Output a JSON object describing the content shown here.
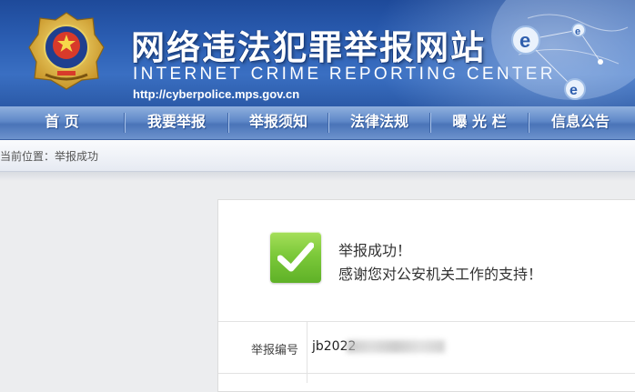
{
  "header": {
    "title_cn": "网络违法犯罪举报网站",
    "title_en": "INTERNET CRIME REPORTING CENTER",
    "url": "http://cyberpolice.mps.gov.cn",
    "emblem_icon": "police-emblem-icon",
    "globe_icon": "globe-network-icon"
  },
  "nav": {
    "items": [
      {
        "label": "首  页"
      },
      {
        "label": "我要举报"
      },
      {
        "label": "举报须知"
      },
      {
        "label": "法律法规"
      },
      {
        "label": "曝 光 栏"
      },
      {
        "label": "信息公告"
      }
    ]
  },
  "breadcrumb": {
    "text": "当前位置：举报成功"
  },
  "result": {
    "icon": "success-check-icon",
    "line1": "举报成功！",
    "line2": "感谢您对公安机关工作的支持！",
    "field_label": "举报编号",
    "field_value_visible": "jb2022"
  },
  "colors": {
    "banner_blue": "#2c5fb4",
    "nav_blue": "#5f88c8",
    "success_green": "#7cc93a"
  }
}
